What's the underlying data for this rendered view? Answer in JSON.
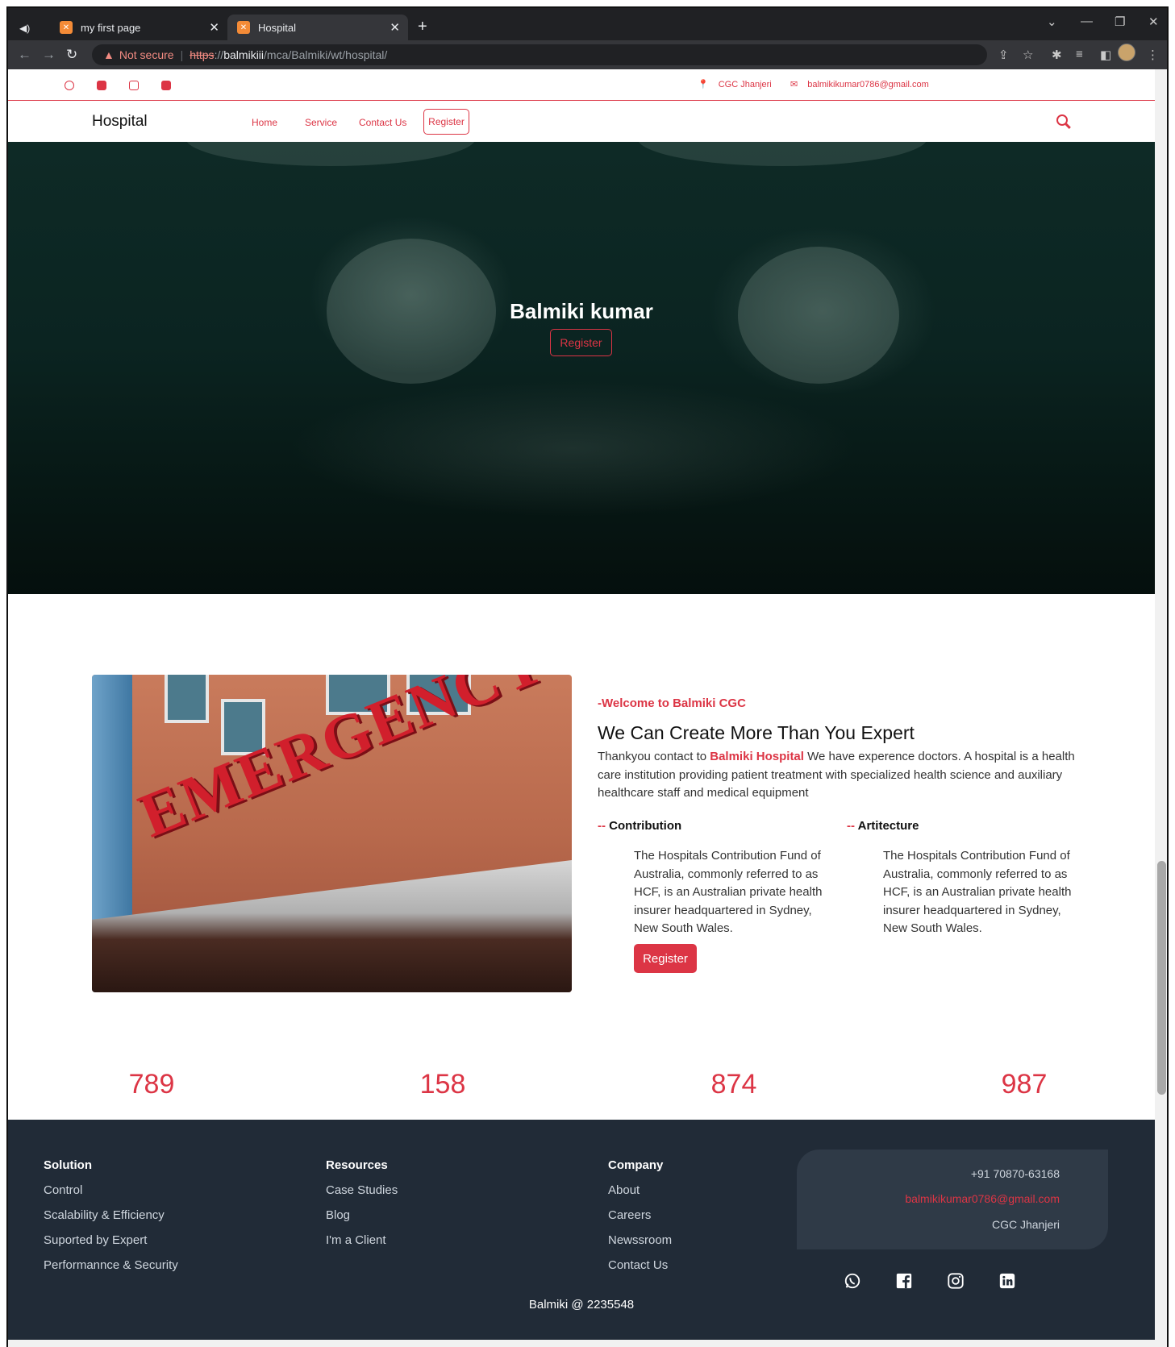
{
  "browser": {
    "tabs": [
      {
        "label": "my first page",
        "active": false
      },
      {
        "label": "Hospital",
        "active": true
      }
    ],
    "address": {
      "warning": "Not secure",
      "scheme": "https",
      "host_sep": "://",
      "host": "balmikiii",
      "path": "/mca/Balmiki/wt/hospital/"
    }
  },
  "topbar": {
    "socials": [
      "whatsapp-icon",
      "facebook-icon",
      "instagram-icon",
      "linkedin-icon"
    ],
    "location": "CGC Jhanjeri",
    "email": "balmikikumar0786@gmail.com"
  },
  "navbar": {
    "brand": "Hospital",
    "links": [
      "Home",
      "Service",
      "Contact Us"
    ],
    "register": "Register"
  },
  "hero": {
    "title": "Balmiki kumar",
    "button": "Register"
  },
  "about": {
    "kicker": "-Welcome to Balmiki CGC",
    "title": "We Can Create More Than You Expert",
    "text_before": "Thankyou contact to ",
    "text_highlight": "Balmiki Hospital",
    "text_after": " We have experence doctors. A hospital is a health care institution providing patient treatment with specialized health science and auxiliary healthcare staff and medical equipment",
    "columns": [
      {
        "dash": "--",
        "title": "Contribution",
        "text": "The Hospitals Contribution Fund of Australia, commonly referred to as HCF, is an Australian private health insurer headquartered in Sydney, New South Wales."
      },
      {
        "dash": "--",
        "title": "Artitecture",
        "text": "The Hospitals Contribution Fund of Australia, commonly referred to as HCF, is an Australian private health insurer headquartered in Sydney, New South Wales."
      }
    ],
    "button": "Register",
    "image_sign": "EMERGENCY"
  },
  "stats": [
    "789",
    "158",
    "874",
    "987"
  ],
  "footer": {
    "columns": [
      {
        "title": "Solution",
        "links": [
          "Control",
          "Scalability & Efficiency",
          "Suported by Expert",
          "Performannce & Security"
        ]
      },
      {
        "title": "Resources",
        "links": [
          "Case Studies",
          "Blog",
          "I'm a Client"
        ]
      },
      {
        "title": "Company",
        "links": [
          "About",
          "Careers",
          "Newssroom",
          "Contact Us"
        ]
      }
    ],
    "contact": {
      "phone": "+91 70870-63168",
      "email": "balmikikumar0786@gmail.com",
      "location": "CGC Jhanjeri"
    },
    "socials": [
      "whatsapp-icon",
      "facebook-icon",
      "instagram-icon",
      "linkedin-icon"
    ],
    "copyright": "Balmiki @ 2235548"
  },
  "colors": {
    "accent": "#dc3545",
    "footer_bg": "#212b37",
    "hero_bg": "#0b2421"
  }
}
